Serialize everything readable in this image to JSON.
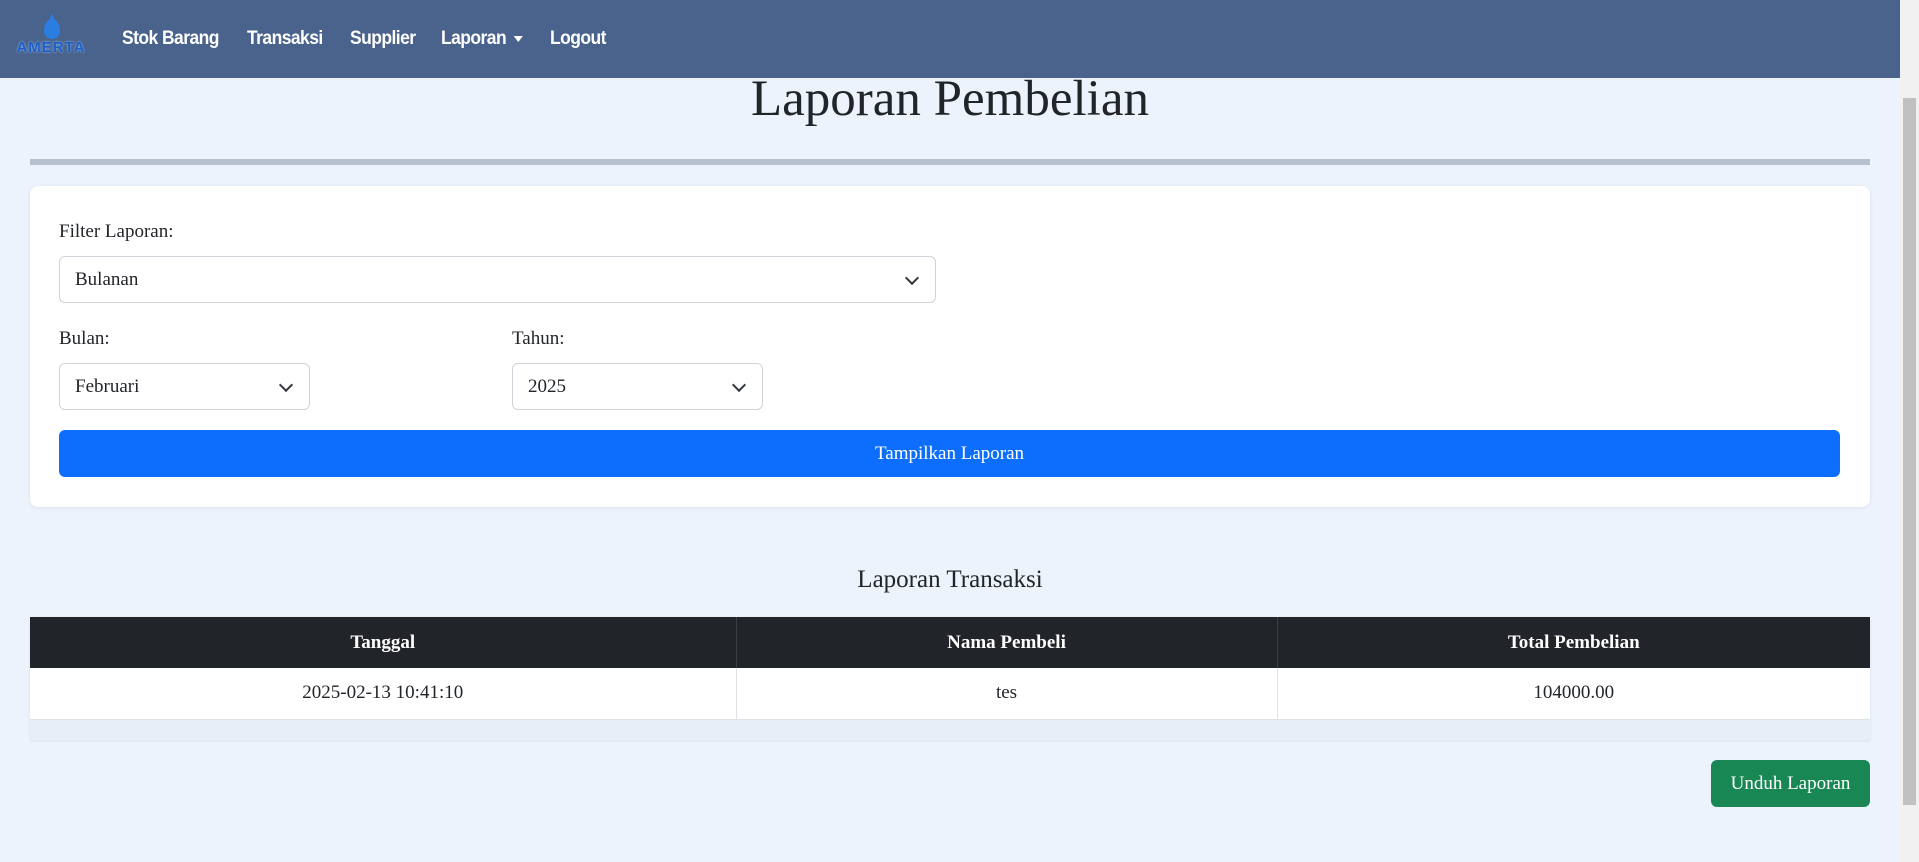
{
  "brand": {
    "logo_text": "AMERTA"
  },
  "nav": {
    "items": [
      "Stok Barang",
      "Transaksi",
      "Supplier",
      "Laporan",
      "Logout"
    ]
  },
  "page": {
    "title": "Laporan Pembelian"
  },
  "filter": {
    "label": "Filter Laporan:",
    "value": "Bulanan",
    "month_label": "Bulan:",
    "month_value": "Februari",
    "year_label": "Tahun:",
    "year_value": "2025",
    "submit_label": "Tampilkan Laporan"
  },
  "report": {
    "title": "Laporan Transaksi",
    "columns": [
      "Tanggal",
      "Nama Pembeli",
      "Total Pembelian"
    ],
    "rows": [
      [
        "2025-02-13 10:41:10",
        "tes",
        "104000.00"
      ]
    ],
    "download_label": "Unduh Laporan"
  },
  "colors": {
    "navbar": "#4a638c",
    "background": "#ecf3fc",
    "primary": "#0d6efd",
    "success": "#198754",
    "table_header": "#212529"
  }
}
